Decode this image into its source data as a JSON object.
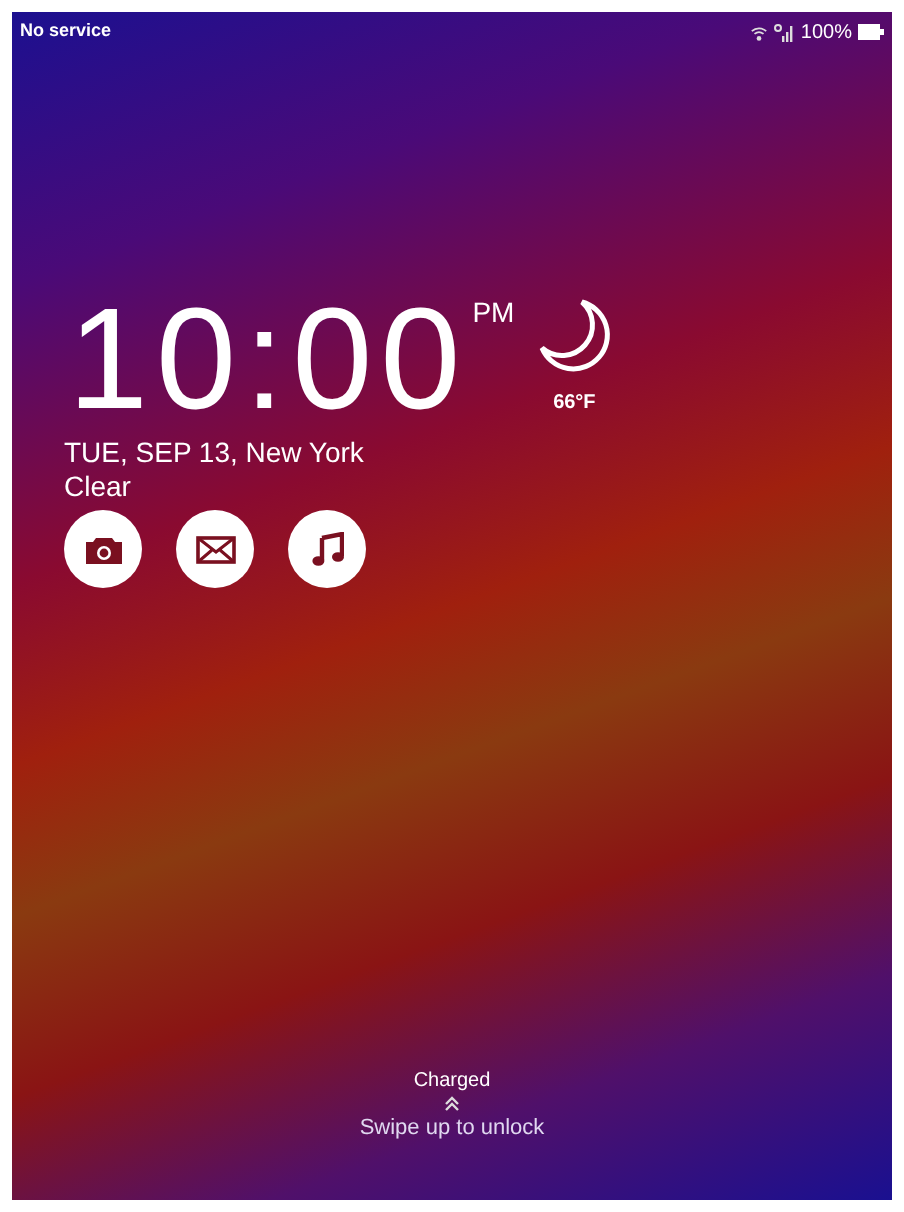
{
  "status_bar": {
    "carrier": "No service",
    "battery_text": "100%"
  },
  "clock": {
    "time": "10:00",
    "meridiem": "PM"
  },
  "weather": {
    "temperature": "66°F"
  },
  "date_location": "TUE, SEP 13, New York",
  "condition": "Clear",
  "shortcuts": [
    {
      "kind": "camera"
    },
    {
      "kind": "mail"
    },
    {
      "kind": "music"
    }
  ],
  "charge_status": "Charged",
  "unlock_hint": "Swipe up to unlock"
}
